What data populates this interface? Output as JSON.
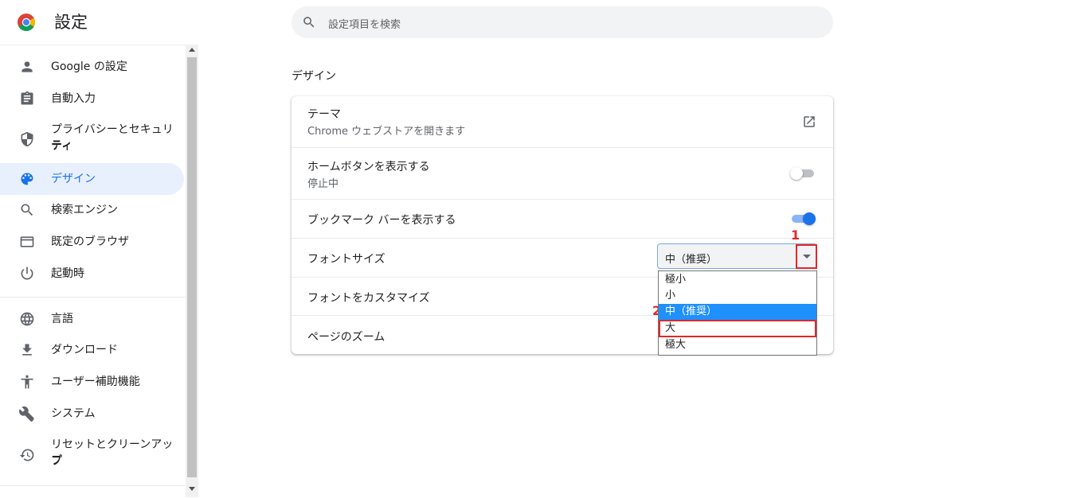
{
  "header": {
    "title": "設定"
  },
  "search": {
    "placeholder": "設定項目を検索"
  },
  "sidebar": {
    "items": [
      {
        "label": "Google の設定",
        "icon": "person-icon"
      },
      {
        "label": "自動入力",
        "icon": "clipboard-icon"
      },
      {
        "label": "プライバシーとセキュリティ",
        "label_line2": "ティ",
        "icon": "shield-icon"
      },
      {
        "label": "デザイン",
        "icon": "palette-icon",
        "selected": true
      },
      {
        "label": "検索エンジン",
        "icon": "search-icon"
      },
      {
        "label": "既定のブラウザ",
        "icon": "browser-icon"
      },
      {
        "label": "起動時",
        "icon": "power-icon"
      },
      {
        "label": "言語",
        "icon": "globe-icon"
      },
      {
        "label": "ダウンロード",
        "icon": "download-icon"
      },
      {
        "label": "ユーザー補助機能",
        "icon": "accessibility-icon"
      },
      {
        "label": "システム",
        "icon": "wrench-icon"
      },
      {
        "label": "リセットとクリーンアップ",
        "label_line2": "プ",
        "icon": "history-icon"
      }
    ]
  },
  "main": {
    "section_title": "デザイン",
    "rows": {
      "theme": {
        "label": "テーマ",
        "sub": "Chrome ウェブストアを開きます"
      },
      "home_button": {
        "label": "ホームボタンを表示する",
        "sub": "停止中",
        "enabled": false
      },
      "bookmarks_bar": {
        "label": "ブックマーク バーを表示する",
        "enabled": true
      },
      "font_size": {
        "label": "フォントサイズ",
        "value": "中（推奨）"
      },
      "customize_fonts": {
        "label": "フォントをカスタマイズ"
      },
      "page_zoom": {
        "label": "ページのズーム"
      }
    },
    "font_size_options": [
      "極小",
      "小",
      "中（推奨）",
      "大",
      "極大"
    ],
    "annotations": {
      "step1": "1",
      "step2": "2"
    }
  },
  "colors": {
    "accent": "#1a73e8",
    "selected_bg": "#e8f0fe",
    "highlight": "#e3262b",
    "option_selected": "#1e90ff"
  }
}
